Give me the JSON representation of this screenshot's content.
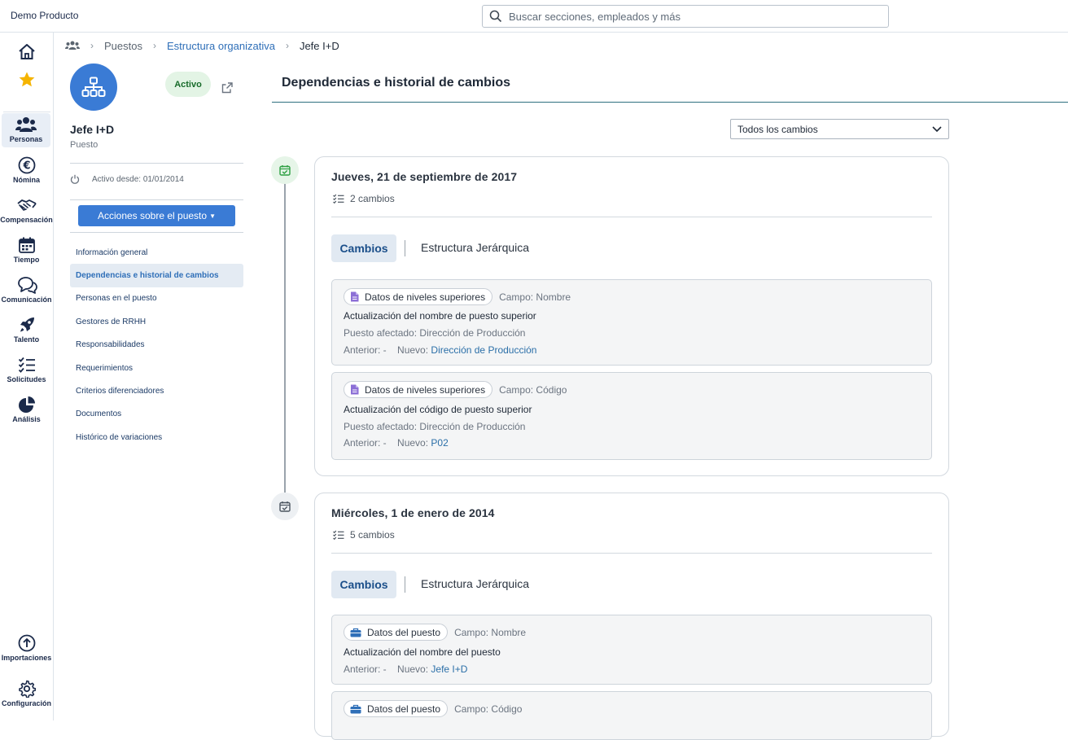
{
  "app": {
    "title": "Demo Producto"
  },
  "search": {
    "placeholder": "Buscar secciones, empleados y más"
  },
  "rail": {
    "top_items": [
      {
        "label": "",
        "icon": "home-icon"
      },
      {
        "label": "",
        "icon": "star-icon"
      }
    ],
    "items": [
      {
        "label": "Personas",
        "icon": "people-icon",
        "active": true
      },
      {
        "label": "Nómina",
        "icon": "euro-icon"
      },
      {
        "label": "Compensación",
        "icon": "handshake-icon"
      },
      {
        "label": "Tiempo",
        "icon": "calendar-icon"
      },
      {
        "label": "Comunicación",
        "icon": "chat-icon"
      },
      {
        "label": "Talento",
        "icon": "rocket-icon"
      },
      {
        "label": "Solicitudes",
        "icon": "checklist-icon"
      },
      {
        "label": "Análisis",
        "icon": "pie-icon"
      }
    ],
    "bottom_items": [
      {
        "label": "Importaciones",
        "icon": "upload-icon"
      },
      {
        "label": "Configuración",
        "icon": "gear-icon"
      }
    ]
  },
  "breadcrumb": {
    "items": [
      "Puestos",
      "Estructura organizativa",
      "Jefe I+D"
    ]
  },
  "position": {
    "name": "Jefe I+D",
    "type": "Puesto",
    "status": "Activo",
    "since": "Activo desde: 01/01/2014",
    "actions_label": "Acciones sobre el puesto"
  },
  "nav": {
    "items": [
      {
        "label": "Información general"
      },
      {
        "label": "Dependencias e historial de cambios",
        "active": true
      },
      {
        "label": "Personas en el puesto"
      },
      {
        "label": "Gestores de RRHH"
      },
      {
        "label": "Responsabilidades"
      },
      {
        "label": "Requerimientos"
      },
      {
        "label": "Criterios diferenciadores"
      },
      {
        "label": "Documentos"
      },
      {
        "label": "Histórico de variaciones"
      }
    ]
  },
  "main": {
    "title": "Dependencias e historial de cambios",
    "filter": "Todos los cambios",
    "tabs": {
      "cambios": "Cambios",
      "estructura": "Estructura Jerárquica"
    },
    "entries": [
      {
        "date": "Jueves, 21 de septiembre de 2017",
        "count": "2 cambios",
        "changes": [
          {
            "chip": "Datos de niveles superiores",
            "campo": "Campo: Nombre",
            "title": "Actualización del nombre de puesto superior",
            "affected": "Puesto afectado: Dirección de Producción",
            "anterior": "Anterior: -",
            "nuevo_label": "Nuevo:",
            "nuevo_value": "Dirección de Producción"
          },
          {
            "chip": "Datos de niveles superiores",
            "campo": "Campo: Código",
            "title": "Actualización del código de puesto superior",
            "affected": "Puesto afectado: Dirección de Producción",
            "anterior": "Anterior: -",
            "nuevo_label": "Nuevo:",
            "nuevo_value": "P02"
          }
        ]
      },
      {
        "date": "Miércoles, 1 de enero de 2014",
        "count": "5 cambios",
        "changes": [
          {
            "chip": "Datos del puesto",
            "campo": "Campo: Nombre",
            "title": "Actualización del nombre del puesto",
            "anterior": "Anterior: -",
            "nuevo_label": "Nuevo:",
            "nuevo_value": "Jefe I+D"
          },
          {
            "chip": "Datos del puesto",
            "campo": "Campo: Código"
          }
        ]
      }
    ]
  },
  "colors": {
    "accent": "#3a7bd5",
    "active_green": "#176b2a",
    "timeline_green": "#2ea043",
    "link": "#2b6fa8"
  }
}
